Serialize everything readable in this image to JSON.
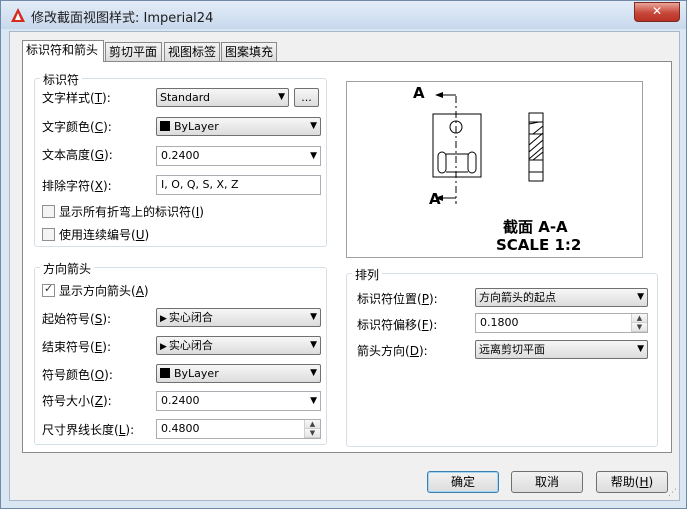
{
  "window": {
    "title": "修改截面视图样式: Imperial24",
    "close_glyph": "✕"
  },
  "tabs": [
    {
      "label": "标识符和箭头",
      "active": true
    },
    {
      "label": "剪切平面",
      "active": false
    },
    {
      "label": "视图标签",
      "active": false
    },
    {
      "label": "图案填充",
      "active": false
    }
  ],
  "identifier": {
    "title": "标识符",
    "text_style": {
      "label": "文字样式",
      "key": "T",
      "value": "Standard",
      "browse": "..."
    },
    "text_color": {
      "label": "文字颜色",
      "key": "C",
      "value": "ByLayer"
    },
    "text_height": {
      "label": "文本高度",
      "key": "G",
      "value": "0.2400"
    },
    "exclude_chars": {
      "label": "排除字符",
      "key": "X",
      "value": "I, O, Q, S, X, Z"
    },
    "show_all_bends": {
      "label": "显示所有折弯上的标识符",
      "key": "I",
      "checked": false
    },
    "continuous_labels": {
      "label": "使用连续编号",
      "key": "U",
      "checked": false
    }
  },
  "direction_arrows": {
    "title": "方向箭头",
    "show": {
      "label": "显示方向箭头",
      "key": "A",
      "checked": true
    },
    "start_symbol": {
      "label": "起始符号",
      "key": "S",
      "value": "实心闭合"
    },
    "end_symbol": {
      "label": "结束符号",
      "key": "E",
      "value": "实心闭合"
    },
    "symbol_color": {
      "label": "符号颜色",
      "key": "O",
      "value": "ByLayer"
    },
    "symbol_size": {
      "label": "符号大小",
      "key": "Z",
      "value": "0.2400"
    },
    "extension_length": {
      "label": "尺寸界线长度",
      "key": "L",
      "value": "0.4800"
    }
  },
  "arrangement": {
    "title": "排列",
    "identifier_position": {
      "label": "标识符位置",
      "key": "P",
      "value": "方向箭头的起点"
    },
    "identifier_offset": {
      "label": "标识符偏移",
      "key": "F",
      "value": "0.1800"
    },
    "arrow_direction": {
      "label": "箭头方向",
      "key": "D",
      "value": "远离剪切平面"
    }
  },
  "preview": {
    "letter_top": "A",
    "letter_bottom": "A",
    "caption_line1": "截面 A-A",
    "caption_line2": "SCALE 1:2"
  },
  "buttons": {
    "ok": "确定",
    "cancel": "取消",
    "help": "帮助",
    "help_key": "H"
  }
}
